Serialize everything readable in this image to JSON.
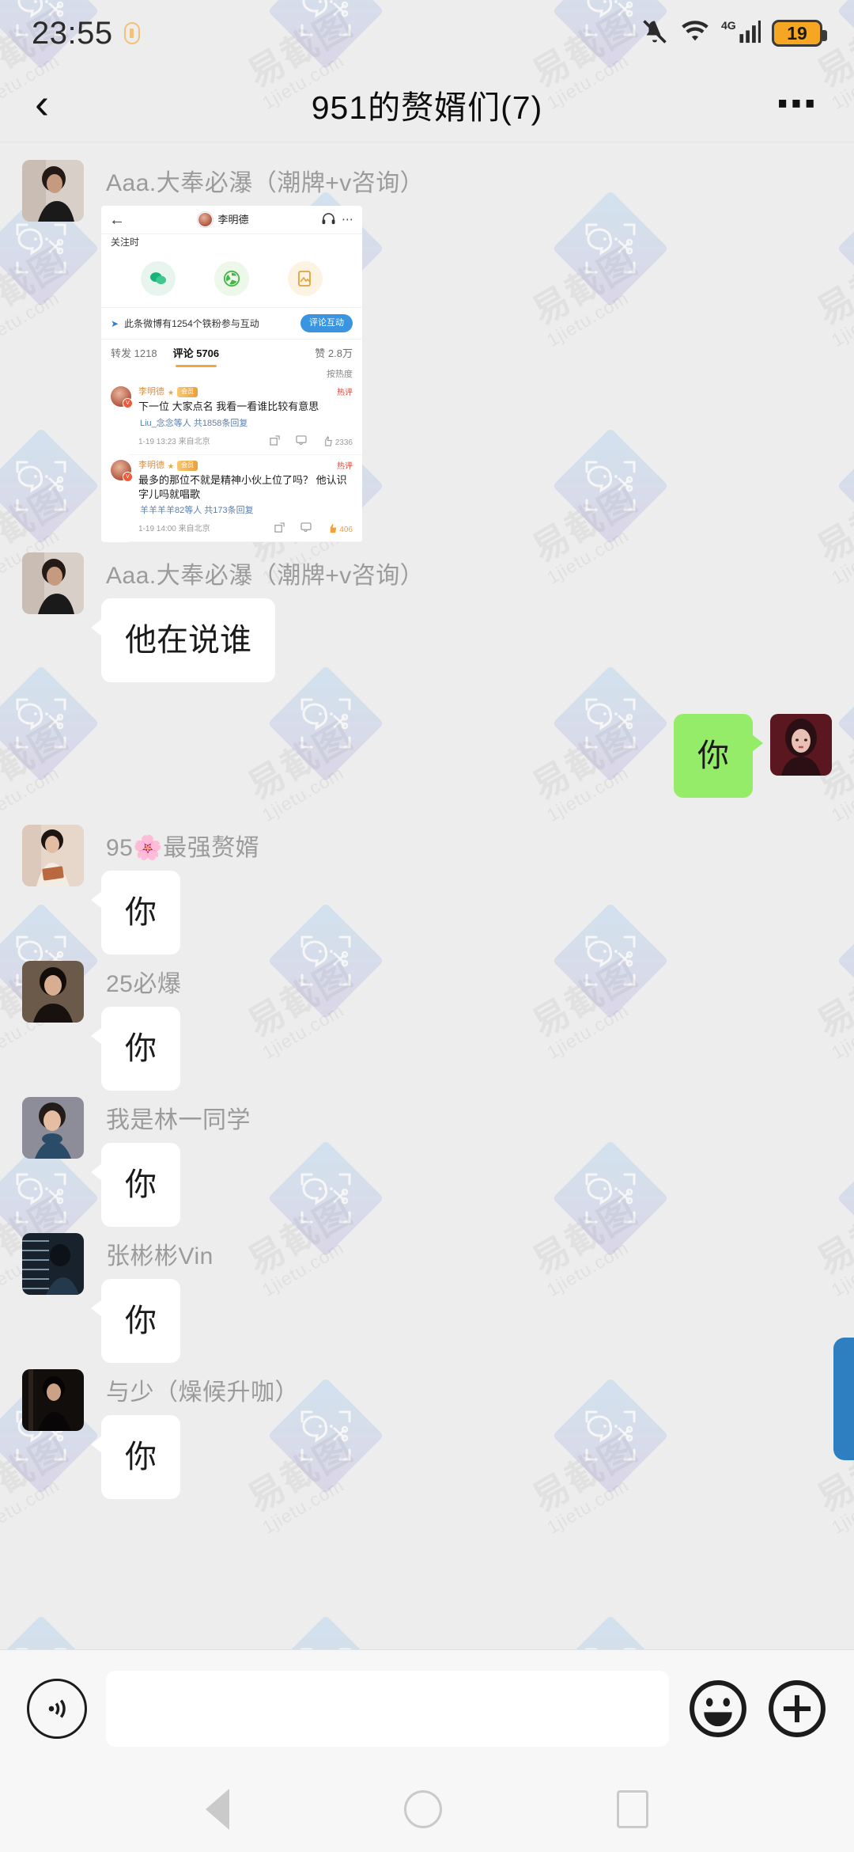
{
  "statusbar": {
    "time": "23:55",
    "battery_percent": "19",
    "network": "4G",
    "icons": [
      "mute-icon",
      "wifi-icon",
      "signal-icon",
      "battery-icon"
    ]
  },
  "header": {
    "back_icon": "‹",
    "title": "951的赘婿们(7)",
    "more_icon": "⋯"
  },
  "watermark": {
    "text_main": "易截图",
    "text_sub": "1jietu.com"
  },
  "messages": [
    {
      "sender": "Aaa.大奉必瀑（潮牌+v咨询）",
      "type": "image",
      "direction": "in"
    },
    {
      "sender": "Aaa.大奉必瀑（潮牌+v咨询）",
      "type": "text",
      "text": "他在说谁",
      "direction": "in"
    },
    {
      "sender": "",
      "type": "text",
      "text": "你",
      "direction": "out"
    },
    {
      "sender": "95🌸最强赘婿",
      "type": "text",
      "text": "你",
      "direction": "in"
    },
    {
      "sender": "25必爆",
      "type": "text",
      "text": "你",
      "direction": "in"
    },
    {
      "sender": "我是林一同学",
      "type": "text",
      "text": "你",
      "direction": "in"
    },
    {
      "sender": "张彬彬Vin",
      "type": "text",
      "text": "你",
      "direction": "in"
    },
    {
      "sender": "与少（燥候升咖）",
      "type": "text",
      "text": "你",
      "direction": "in"
    }
  ],
  "weibo_screenshot": {
    "nav": {
      "back_icon": "←",
      "username": "李明德",
      "headphone_icon": "♫",
      "more_icon": "⋯"
    },
    "subtitle": "关注时",
    "action_icons": [
      "comment-icon",
      "share-icon",
      "image-icon"
    ],
    "fan_banner": {
      "text": "此条微博有1254个铁粉参与互动",
      "button": "评论互动"
    },
    "stats": {
      "repost_label": "转发",
      "repost_count": "1218",
      "comment_label": "评论",
      "comment_count": "5706",
      "like_label": "赞",
      "like_count": "2.8万"
    },
    "sort": "按热度",
    "comments": [
      {
        "name": "李明德",
        "vip_badge": "会员",
        "hot_tag": "热评",
        "text": "下一位 大家点名 我看一看谁比较有意思",
        "reply": "Liu_念念等人 共1858条回复",
        "time": "1-19 13:23 来自北京",
        "likes": "2336"
      },
      {
        "name": "李明德",
        "vip_badge": "会员",
        "hot_tag": "热评",
        "text": "最多的那位不就是精神小伙上位了吗？ 他认识字儿吗就唱歌",
        "reply": "羊羊羊羊82等人 共173条回复",
        "time": "1-19 14:00 来自北京",
        "likes": "406"
      }
    ]
  },
  "inputbar": {
    "voice_icon": "voice-icon",
    "input_value": "",
    "input_placeholder": "",
    "emoji_icon": "emoji-icon",
    "plus_icon": "plus-icon"
  },
  "navbar": {
    "back_icon": "back-triangle-icon",
    "home_icon": "home-circle-icon",
    "recents_icon": "recents-square-icon"
  },
  "colors": {
    "background": "#ededed",
    "out_bubble": "#95ec69",
    "in_bubble": "#ffffff",
    "battery": "#f5a623",
    "side_handle": "#2e7fc1"
  }
}
